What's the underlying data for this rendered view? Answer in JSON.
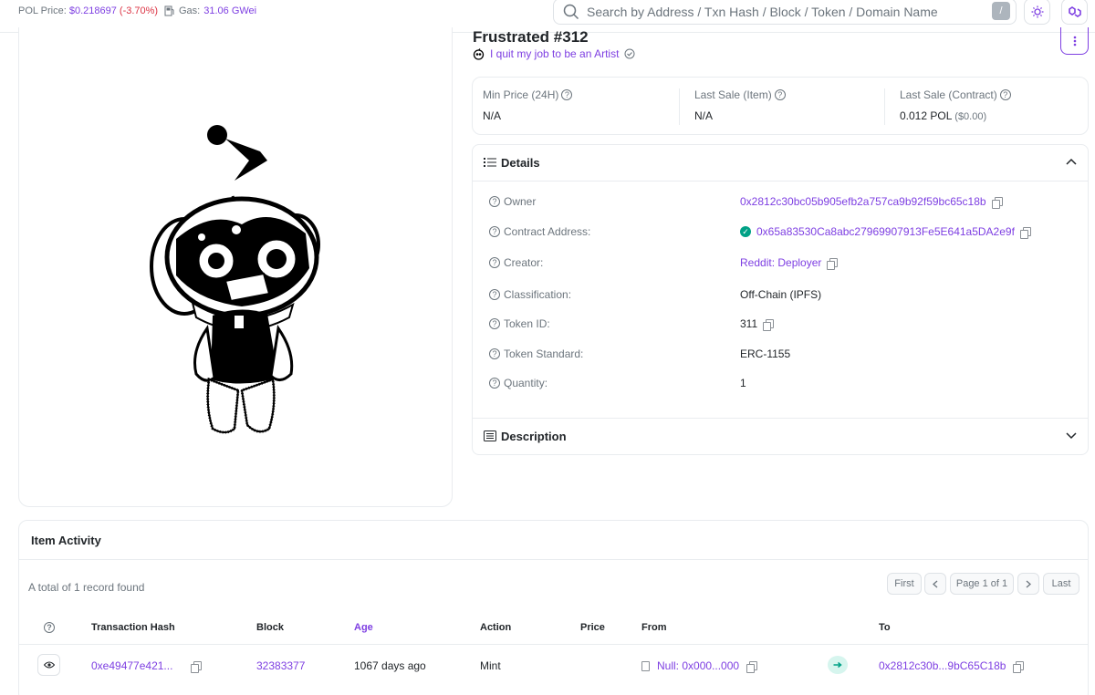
{
  "topbar": {
    "pol_price_label": "POL Price:",
    "pol_price_value": "$0.218697",
    "pol_price_change": "(-3.70%)",
    "gas_label": "Gas:",
    "gas_value": "31.06 GWei",
    "search_placeholder": "Search by Address / Txn Hash / Block / Token / Domain Name",
    "search_shortcut": "/"
  },
  "nft": {
    "title": "Frustrated #312",
    "collection": "I quit my job to be an Artist"
  },
  "stats": [
    {
      "label": "Min Price (24H)",
      "value": "N/A",
      "sub": ""
    },
    {
      "label": "Last Sale (Item)",
      "value": "N/A",
      "sub": ""
    },
    {
      "label": "Last Sale (Contract)",
      "value": "0.012 POL",
      "sub": "($0.00)"
    }
  ],
  "details": {
    "title": "Details",
    "rows": [
      {
        "key": "Owner",
        "value": "0x2812c30bc05b905efb2a757ca9b92f59bc65c18b"
      },
      {
        "key": "Contract Address:",
        "value": "0x65a83530Ca8abc27969907913Fe5E641a5DA2e9f"
      },
      {
        "key": "Creator:",
        "value": "Reddit: Deployer"
      },
      {
        "key": "Classification:",
        "value": "Off-Chain (IPFS)"
      },
      {
        "key": "Token ID:",
        "value": "311"
      },
      {
        "key": "Token Standard:",
        "value": "ERC-1155"
      },
      {
        "key": "Quantity:",
        "value": "1"
      }
    ],
    "description_title": "Description"
  },
  "activity": {
    "title": "Item Activity",
    "total": "A total of 1 record found",
    "pager": {
      "first": "First",
      "page": "Page 1 of 1",
      "last": "Last"
    },
    "columns": [
      "Transaction Hash",
      "Block",
      "Age",
      "Action",
      "Price",
      "From",
      "To"
    ],
    "rows": [
      {
        "txn_hash": "0xe49477e421...",
        "block": "32383377",
        "age": "1067 days ago",
        "action": "Mint",
        "price": "",
        "from": "Null: 0x000...000",
        "to": "0x2812c30b...9bC65C18b"
      }
    ]
  },
  "colors": {
    "accent": "#7e3fe2",
    "negative": "#dc3545",
    "verified": "#00a186"
  }
}
